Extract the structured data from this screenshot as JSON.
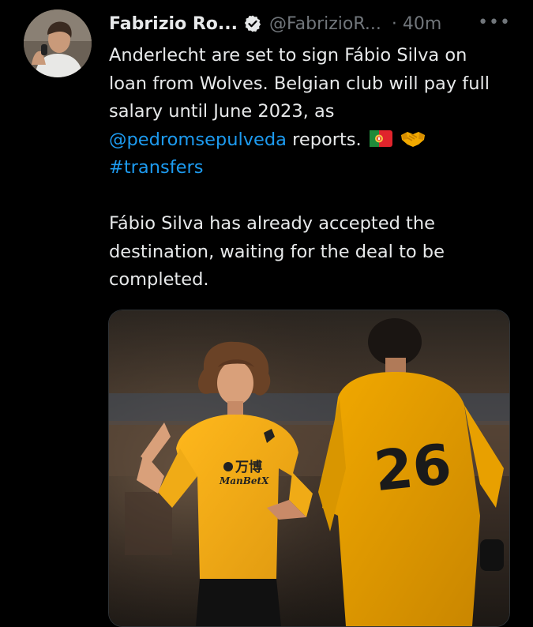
{
  "tweet": {
    "author": {
      "name": "Fabrizio Ro...",
      "handle": "@FabrizioR...",
      "verified": true,
      "avatar_icon": "profile-photo-avatar"
    },
    "separator": "·",
    "time": "40m",
    "more_label": "•••",
    "paragraph1": {
      "line1": "Anderlecht are set to sign Fábio Silva on",
      "line2": "loan from Wolves. Belgian club will pay full",
      "line3": "salary until June 2023, as",
      "mention": "@pedromsepulveda",
      "after_mention": " reports.",
      "emojis": [
        "portugal-flag-icon",
        "handshake-icon"
      ],
      "hashtag": "#transfers"
    },
    "paragraph2": {
      "line1": "Fábio Silva has already accepted the",
      "line2": "destination, waiting for the deal to be",
      "line3": "completed."
    },
    "media": {
      "type": "photo",
      "shirt_sponsor_top": "万博",
      "shirt_sponsor_bottom": "ManBetX",
      "shirt_number": "26"
    }
  },
  "colors": {
    "background": "#000000",
    "text": "#e7e9ea",
    "secondary": "#71767b",
    "link": "#1d9bf0",
    "wolves_gold": "#f2a900"
  }
}
